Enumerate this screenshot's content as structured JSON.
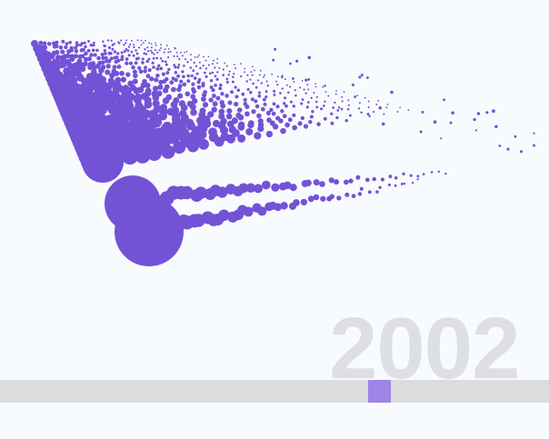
{
  "year": {
    "label": "2002",
    "color": "#dedfe2"
  },
  "slider": {
    "position": 0.69,
    "track_color": "#dcdcdc",
    "handle_color": "#9e85e6"
  },
  "dots": {
    "color": "#7352d6"
  }
}
